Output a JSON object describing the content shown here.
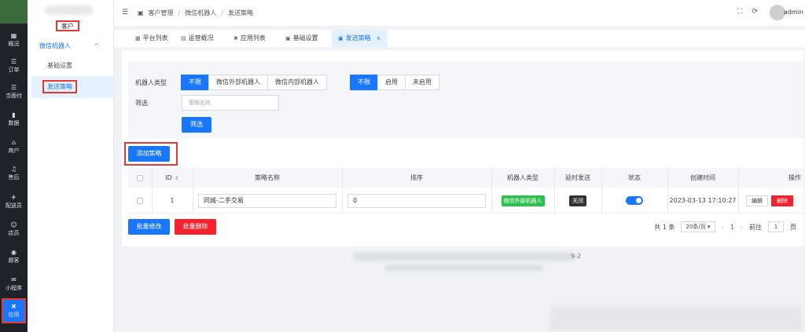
{
  "rail": {
    "items": [
      {
        "label": "概况",
        "icon": "dashboard-icon",
        "glyph": "▦"
      },
      {
        "label": "订单",
        "icon": "list-icon",
        "glyph": "☰"
      },
      {
        "label": "当面付",
        "icon": "list-icon",
        "glyph": "☰"
      },
      {
        "label": "数据",
        "icon": "bar-chart-icon",
        "glyph": "▮"
      },
      {
        "label": "商户",
        "icon": "store-icon",
        "glyph": "⌂"
      },
      {
        "label": "售后",
        "icon": "headset-icon",
        "glyph": "♫"
      },
      {
        "label": "配送员",
        "icon": "delivery-icon",
        "glyph": "✈"
      },
      {
        "label": "店员",
        "icon": "clerk-icon",
        "glyph": "☺"
      },
      {
        "label": "顾客",
        "icon": "customer-icon",
        "glyph": "◉"
      },
      {
        "label": "小程序",
        "icon": "wechat-icon",
        "glyph": "✉"
      },
      {
        "label": "应用",
        "icon": "apps-icon",
        "glyph": "✖"
      }
    ]
  },
  "submenu": {
    "title": "客户",
    "group": "微信机器人",
    "items": [
      "基础设置",
      "发送策略"
    ]
  },
  "header": {
    "menu_glyph": "☰",
    "crumbs": [
      "客户管理",
      "微信机器人",
      "发送策略"
    ],
    "user": "admin"
  },
  "tabs": [
    "平台列表",
    "运营概况",
    "应用列表",
    "基础设置",
    "发送策略"
  ],
  "filter": {
    "robot_type_label": "机器人类型",
    "robot_types": [
      "不限",
      "微信外部机器人",
      "微信内部机器人"
    ],
    "status_options": [
      "不限",
      "启用",
      "未启用"
    ],
    "filter_label": "筛选",
    "name_placeholder": "策略名称",
    "filter_button": "筛选"
  },
  "add_button": "添加策略",
  "table": {
    "headers": [
      "ID",
      "策略名称",
      "排序",
      "机器人类型",
      "延时发送",
      "状态",
      "创建时间",
      "操作"
    ],
    "rows": [
      {
        "id": "1",
        "name": "同城-二手交易",
        "sort": "0",
        "robot_type": "微信外部机器人",
        "delay": "关闭",
        "status_on": true,
        "created": "2023-03-13 17:10:27",
        "edit": "编辑",
        "delete": "删除"
      }
    ]
  },
  "bulk": {
    "edit": "批量修改",
    "delete": "批量删除"
  },
  "pager": {
    "total": "共 1 条",
    "page_size": "20条/页",
    "page": "1",
    "goto_label": "前往",
    "goto_value": "1",
    "goto_suffix": "页",
    "prev": "‹",
    "next": "›"
  },
  "footer": {
    "version": "9-2"
  },
  "colors": {
    "primary": "#1976ff",
    "danger": "#f5222d",
    "success": "#2dbf4f",
    "highlight": "#e53935"
  }
}
